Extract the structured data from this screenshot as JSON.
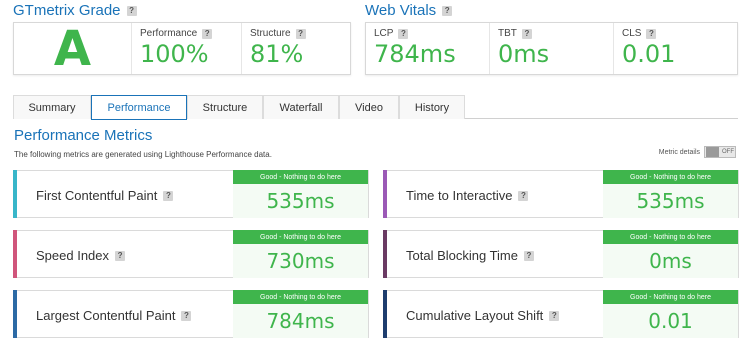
{
  "grade_section": {
    "title": "GTmetrix Grade",
    "grade": "A",
    "performance_label": "Performance",
    "performance_value": "100%",
    "structure_label": "Structure",
    "structure_value": "81%"
  },
  "web_vitals": {
    "title": "Web Vitals",
    "items": [
      {
        "label": "LCP",
        "value": "784ms"
      },
      {
        "label": "TBT",
        "value": "0ms"
      },
      {
        "label": "CLS",
        "value": "0.01"
      }
    ]
  },
  "tabs": [
    "Summary",
    "Performance",
    "Structure",
    "Waterfall",
    "Video",
    "History"
  ],
  "active_tab": "Performance",
  "performance_metrics": {
    "title": "Performance Metrics",
    "description": "The following metrics are generated using Lighthouse Performance data.",
    "metric_details_label": "Metric details",
    "toggle_state": "OFF"
  },
  "help_glyph": "?",
  "metrics": [
    {
      "label": "First Contentful Paint",
      "status": "Good - Nothing to do here",
      "value": "535ms",
      "color": "#38b6c9"
    },
    {
      "label": "Time to Interactive",
      "status": "Good - Nothing to do here",
      "value": "535ms",
      "color": "#9b59b6"
    },
    {
      "label": "Speed Index",
      "status": "Good - Nothing to do here",
      "value": "730ms",
      "color": "#d0557b"
    },
    {
      "label": "Total Blocking Time",
      "status": "Good - Nothing to do here",
      "value": "0ms",
      "color": "#6a3a63"
    },
    {
      "label": "Largest Contentful Paint",
      "status": "Good - Nothing to do here",
      "value": "784ms",
      "color": "#2c6aa5"
    },
    {
      "label": "Cumulative Layout Shift",
      "status": "Good - Nothing to do here",
      "value": "0.01",
      "color": "#1d3d6e"
    }
  ],
  "colors": {
    "accent_blue": "#1a73b8",
    "good_green": "#3fb54c"
  }
}
